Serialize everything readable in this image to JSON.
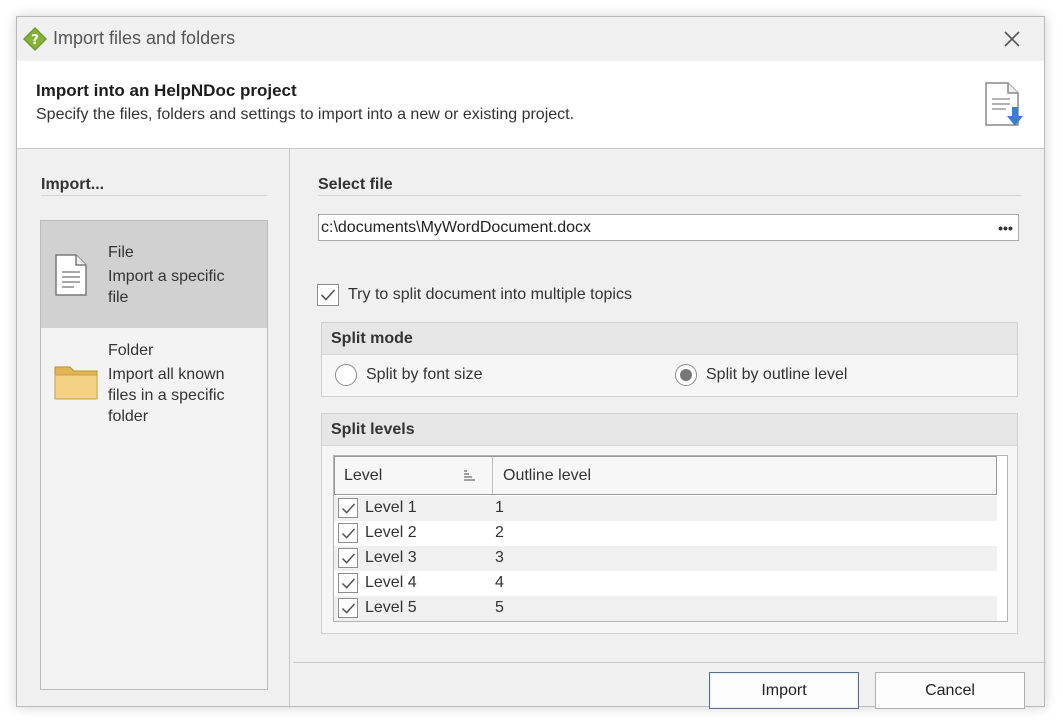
{
  "window": {
    "title": "Import files and folders",
    "icon": "helpndoc-question-icon",
    "close_icon": "close-icon"
  },
  "header": {
    "title": "Import into an HelpNDoc project",
    "subtitle": "Specify the files, folders and settings to import into a new or existing project.",
    "icon": "import-document-icon"
  },
  "left": {
    "heading": "Import...",
    "items": [
      {
        "title": "File",
        "description_lines": [
          "Import a specific",
          "file"
        ],
        "icon": "document-icon",
        "selected": true
      },
      {
        "title": "Folder",
        "description_lines": [
          "Import all known",
          "files in a specific",
          "folder"
        ],
        "icon": "folder-icon",
        "selected": false
      }
    ]
  },
  "select_file": {
    "heading": "Select file",
    "value": "c:\\documents\\MyWordDocument.docx",
    "browse_label": "•••"
  },
  "split_toggle": {
    "label": "Try to split document into multiple topics",
    "checked": true
  },
  "split_mode": {
    "heading": "Split mode",
    "options": [
      {
        "label": "Split by font size",
        "selected": false
      },
      {
        "label": "Split by outline level",
        "selected": true
      }
    ]
  },
  "split_levels": {
    "heading": "Split levels",
    "columns": [
      "Level",
      "Outline level"
    ],
    "rows": [
      {
        "level": "Level 1",
        "outline": "1",
        "checked": true
      },
      {
        "level": "Level 2",
        "outline": "2",
        "checked": true
      },
      {
        "level": "Level 3",
        "outline": "3",
        "checked": true
      },
      {
        "level": "Level 4",
        "outline": "4",
        "checked": true
      },
      {
        "level": "Level 5",
        "outline": "5",
        "checked": true
      }
    ]
  },
  "buttons": {
    "import": "Import",
    "cancel": "Cancel"
  },
  "colors": {
    "accent_green": "#6a9a2a",
    "folder_yellow": "#f2cf7a",
    "doc_blue": "#3a7fd0",
    "selected_bg": "#d1d1d1"
  }
}
